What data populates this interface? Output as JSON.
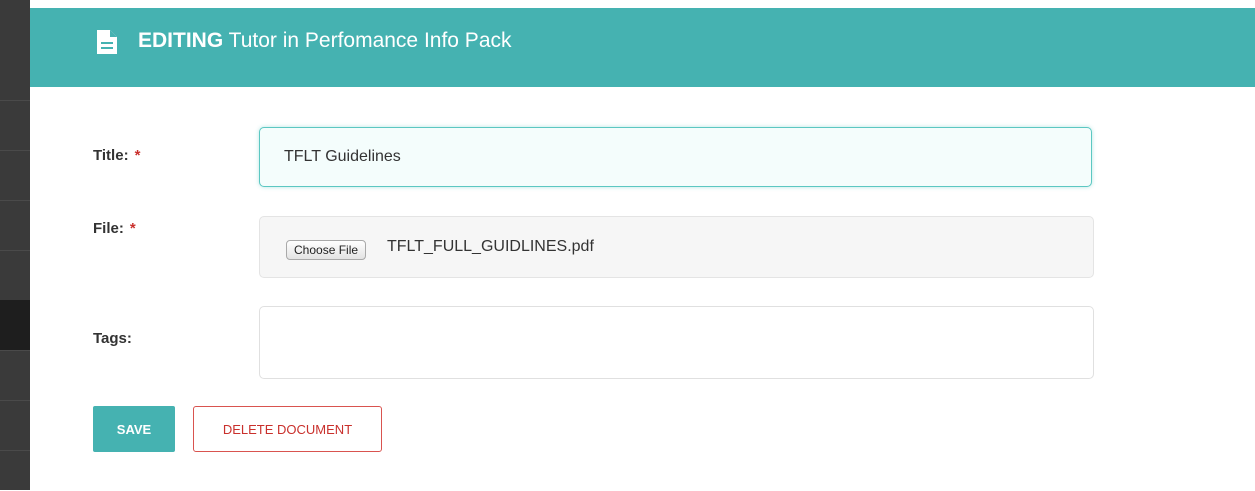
{
  "header": {
    "prefix": "EDITING",
    "document_name": "Tutor in Perfomance Info Pack",
    "icon": "document-icon"
  },
  "form": {
    "title": {
      "label": "Title:",
      "required_mark": "*",
      "value": "TFLT Guidelines"
    },
    "file": {
      "label": "File:",
      "required_mark": "*",
      "button_label": "Choose File",
      "file_name": "TFLT_FULL_GUIDLINES.pdf"
    },
    "tags": {
      "label": "Tags:",
      "value": ""
    }
  },
  "actions": {
    "save_label": "SAVE",
    "delete_label": "DELETE DOCUMENT"
  },
  "colors": {
    "accent": "#45b2b1",
    "danger": "#c9302c",
    "sidebar": "#3a3a3a"
  }
}
